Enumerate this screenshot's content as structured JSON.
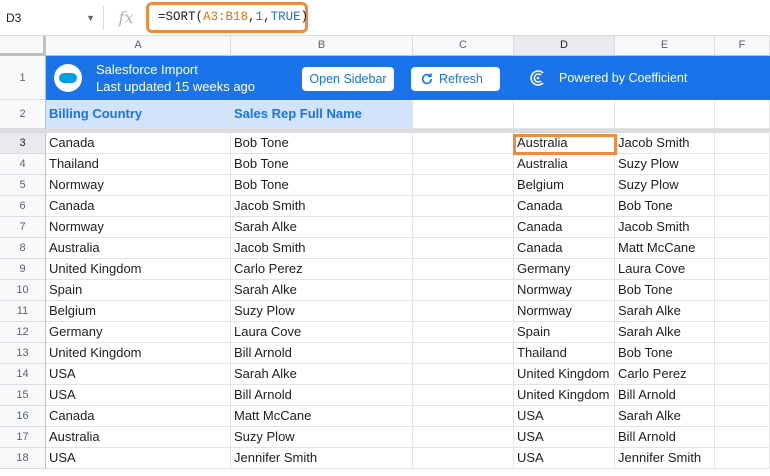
{
  "formula_bar": {
    "name_box": "D3",
    "fx_label": "fx",
    "formula_fn": "=SORT(",
    "formula_range": "A3:B18",
    "formula_sep1": ",",
    "formula_num": "1",
    "formula_sep2": ",",
    "formula_bool": "TRUE",
    "formula_close": ")"
  },
  "columns": [
    "A",
    "B",
    "C",
    "D",
    "E",
    "F"
  ],
  "banner": {
    "title": "Salesforce Import",
    "subtitle": "Last updated 15 weeks ago",
    "open_sidebar_label": "Open Sidebar",
    "refresh_label": "Refresh",
    "powered_label": "Powered by Coefficient",
    "accent_color": "#1a73e8"
  },
  "header_row": {
    "col_a": "Billing Country",
    "col_b": "Sales Rep Full Name"
  },
  "row_numbers": [
    "1",
    "2",
    "3",
    "4",
    "5",
    "6",
    "7",
    "8",
    "9",
    "10",
    "11",
    "12",
    "13",
    "14",
    "15",
    "16",
    "17",
    "18"
  ],
  "rows": [
    {
      "a": "Canada",
      "b": "Bob Tone",
      "d": "Australia",
      "e": "Jacob Smith"
    },
    {
      "a": "Thailand",
      "b": "Bob Tone",
      "d": "Australia",
      "e": "Suzy Plow"
    },
    {
      "a": "Normway",
      "b": "Bob Tone",
      "d": "Belgium",
      "e": "Suzy Plow"
    },
    {
      "a": "Canada",
      "b": "Jacob Smith",
      "d": "Canada",
      "e": "Bob Tone"
    },
    {
      "a": "Normway",
      "b": "Sarah Alke",
      "d": "Canada",
      "e": "Jacob Smith"
    },
    {
      "a": "Australia",
      "b": "Jacob Smith",
      "d": "Canada",
      "e": "Matt McCane"
    },
    {
      "a": "United Kingdom",
      "b": "Carlo Perez",
      "d": "Germany",
      "e": "Laura Cove"
    },
    {
      "a": "Spain",
      "b": "Sarah Alke",
      "d": "Normway",
      "e": "Bob Tone"
    },
    {
      "a": "Belgium",
      "b": "Suzy Plow",
      "d": "Normway",
      "e": "Sarah Alke"
    },
    {
      "a": "Germany",
      "b": "Laura Cove",
      "d": "Spain",
      "e": "Sarah Alke"
    },
    {
      "a": "United Kingdom",
      "b": "Bill Arnold",
      "d": "Thailand",
      "e": "Bob Tone"
    },
    {
      "a": "USA",
      "b": "Sarah Alke",
      "d": "United Kingdom",
      "e": "Carlo Perez"
    },
    {
      "a": "USA",
      "b": "Bill Arnold",
      "d": "United Kingdom",
      "e": "Bill Arnold"
    },
    {
      "a": "Canada",
      "b": "Matt McCane",
      "d": "USA",
      "e": "Sarah Alke"
    },
    {
      "a": "Australia",
      "b": "Suzy Plow",
      "d": "USA",
      "e": "Bill Arnold"
    },
    {
      "a": "USA",
      "b": "Jennifer Smith",
      "d": "USA",
      "e": "Jennifer Smith"
    }
  ]
}
